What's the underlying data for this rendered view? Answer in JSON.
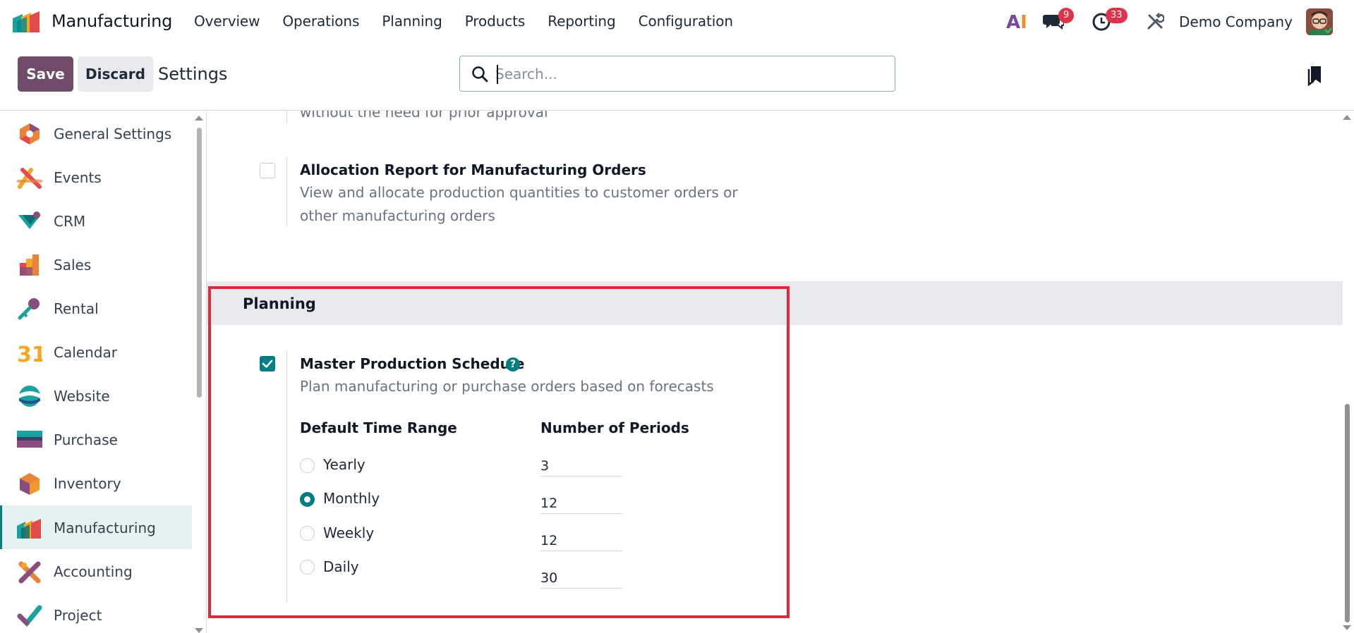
{
  "navbar": {
    "app_name": "Manufacturing",
    "menu": [
      "Overview",
      "Operations",
      "Planning",
      "Products",
      "Reporting",
      "Configuration"
    ],
    "ai_label": "AI",
    "messages_count": "9",
    "activities_count": "33",
    "company": "Demo Company"
  },
  "control": {
    "save_label": "Save",
    "discard_label": "Discard",
    "title": "Settings",
    "search_placeholder": "Search..."
  },
  "sidebar": {
    "items": [
      {
        "label": "General Settings",
        "icon": "general-settings-icon"
      },
      {
        "label": "Events",
        "icon": "events-icon"
      },
      {
        "label": "CRM",
        "icon": "crm-icon"
      },
      {
        "label": "Sales",
        "icon": "sales-icon"
      },
      {
        "label": "Rental",
        "icon": "rental-icon"
      },
      {
        "label": "Calendar",
        "icon": "calendar-icon"
      },
      {
        "label": "Website",
        "icon": "website-icon"
      },
      {
        "label": "Purchase",
        "icon": "purchase-icon"
      },
      {
        "label": "Inventory",
        "icon": "inventory-icon"
      },
      {
        "label": "Manufacturing",
        "icon": "manufacturing-icon"
      },
      {
        "label": "Accounting",
        "icon": "accounting-icon"
      },
      {
        "label": "Project",
        "icon": "project-icon"
      }
    ],
    "active": "Manufacturing",
    "calendar_number": "31"
  },
  "content": {
    "prev_desc": "without the need for prior approval",
    "allocation": {
      "title": "Allocation Report for Manufacturing Orders",
      "desc_line1": "View and allocate production quantities to customer orders or",
      "desc_line2": "other manufacturing orders",
      "checked": false
    },
    "planning_section": {
      "title": "Planning",
      "mps": {
        "title": "Master Production Schedule",
        "help": "?",
        "desc": "Plan manufacturing or purchase orders based on forecasts",
        "checked": true,
        "time_range_label": "Default Time Range",
        "periods_label": "Number of Periods",
        "options": [
          {
            "label": "Yearly",
            "periods": "3",
            "selected": false
          },
          {
            "label": "Monthly",
            "periods": "12",
            "selected": true
          },
          {
            "label": "Weekly",
            "periods": "12",
            "selected": false
          },
          {
            "label": "Daily",
            "periods": "30",
            "selected": false
          }
        ]
      }
    }
  },
  "colors": {
    "primary": "#714b67",
    "teal": "#017e84",
    "highlight": "#e0293a",
    "badge": "#e0334a"
  }
}
